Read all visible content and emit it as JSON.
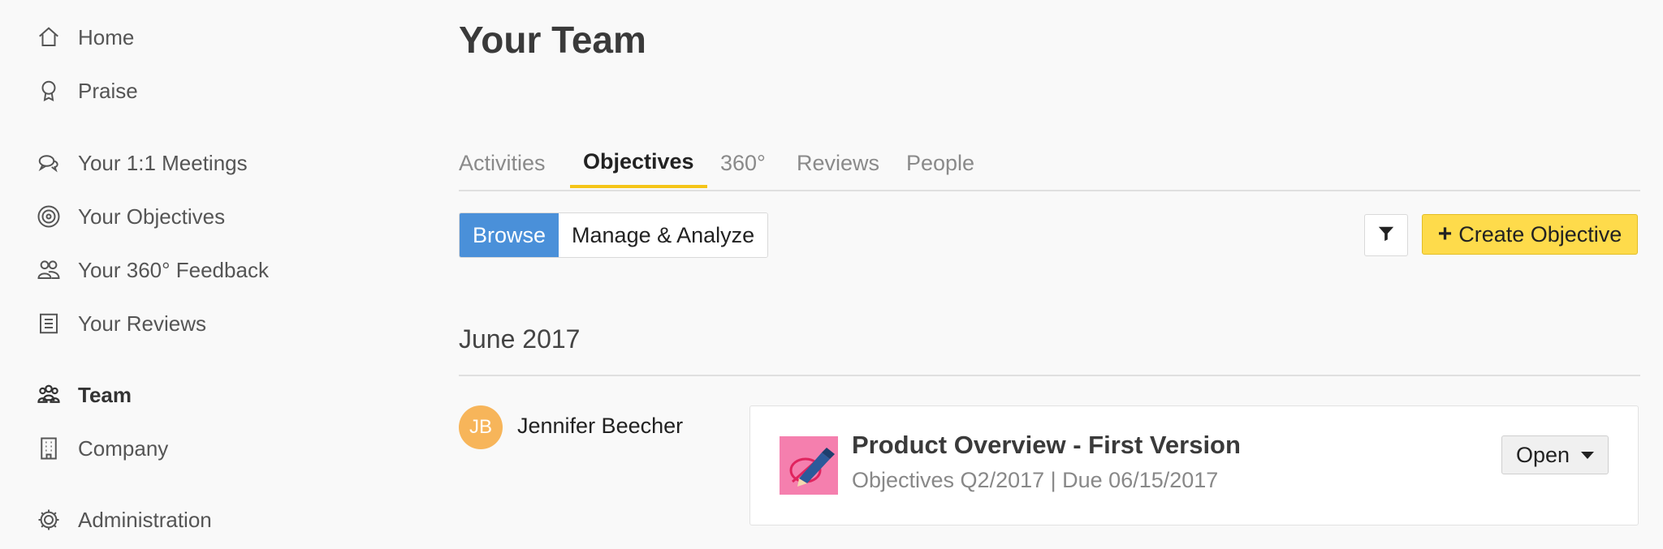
{
  "sidebar": {
    "items": [
      {
        "label": "Home",
        "icon": "home-icon"
      },
      {
        "label": "Praise",
        "icon": "praise-icon"
      },
      {
        "label": "Your 1:1 Meetings",
        "icon": "meetings-icon"
      },
      {
        "label": "Your Objectives",
        "icon": "target-icon"
      },
      {
        "label": "Your 360° Feedback",
        "icon": "feedback-icon"
      },
      {
        "label": "Your Reviews",
        "icon": "reviews-icon"
      },
      {
        "label": "Team",
        "icon": "team-icon",
        "active": true
      },
      {
        "label": "Company",
        "icon": "company-icon"
      },
      {
        "label": "Administration",
        "icon": "gear-icon"
      }
    ]
  },
  "main": {
    "title": "Your Team",
    "tabs": [
      {
        "label": "Activities"
      },
      {
        "label": "Objectives",
        "active": true
      },
      {
        "label": "360°"
      },
      {
        "label": "Reviews"
      },
      {
        "label": "People"
      }
    ],
    "view_toggle": {
      "browse": "Browse",
      "manage": "Manage & Analyze",
      "active": "Browse"
    },
    "filter_icon": "filter-icon",
    "create_button": {
      "plus": "+",
      "label": "Create Objective"
    },
    "section_date": "June 2017",
    "person": {
      "initials": "JB",
      "name": "Jennifer Beecher"
    },
    "objective": {
      "title": "Product Overview - First Version",
      "subtitle": "Objectives Q2/2017 | Due 06/15/2017",
      "status": "Open",
      "icon": "pencil-target-icon"
    }
  },
  "colors": {
    "accent_blue": "#4a90d9",
    "accent_yellow": "#fedb4b",
    "tab_underline": "#f5c518",
    "avatar": "#f7b55a"
  }
}
